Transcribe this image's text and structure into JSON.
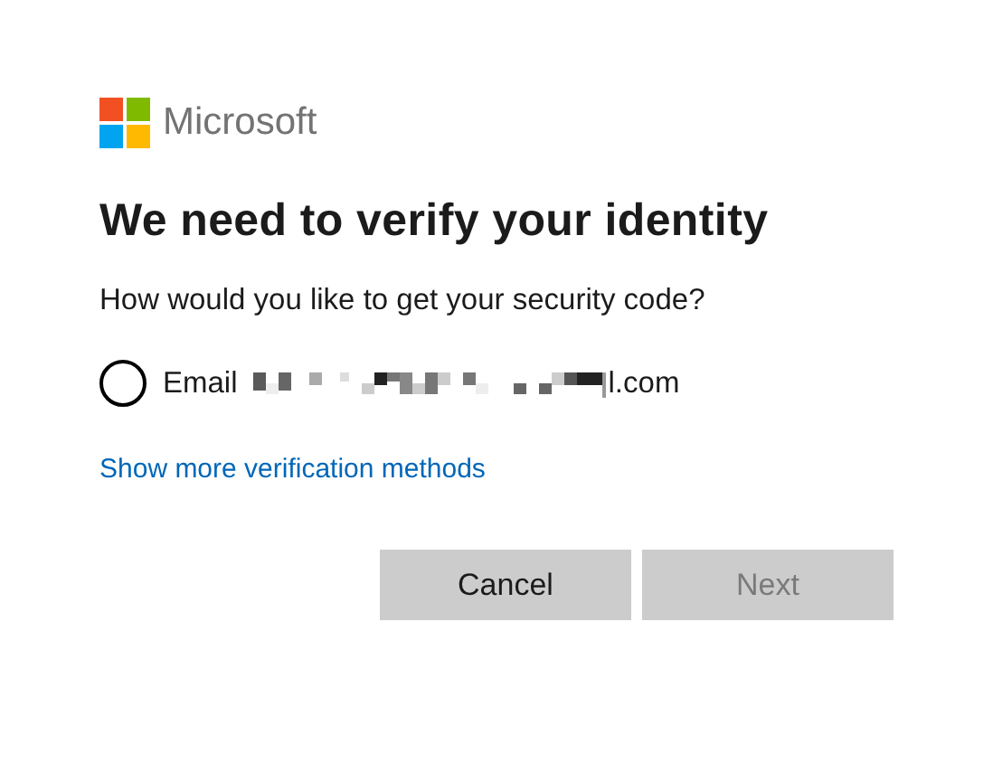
{
  "logo": {
    "text": "Microsoft"
  },
  "title": "We need to verify your identity",
  "prompt": "How would you like to get your security code?",
  "options": [
    {
      "label": "Email",
      "redacted": true,
      "suffix": "l.com",
      "selected": false
    }
  ],
  "link": "Show more verification methods",
  "buttons": [
    {
      "label": "Cancel",
      "disabled": false
    },
    {
      "label": "Next",
      "disabled": true
    }
  ]
}
